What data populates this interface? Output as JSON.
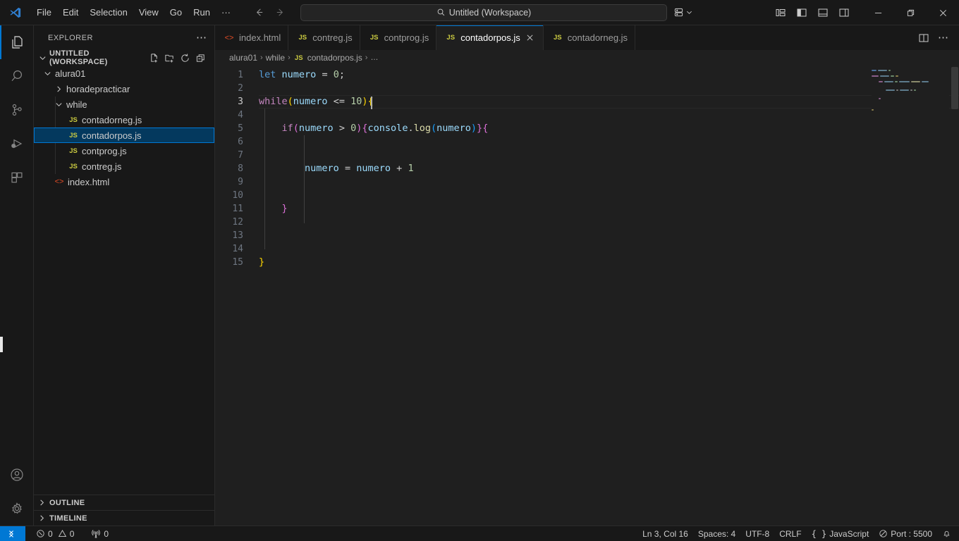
{
  "titlebar": {
    "logo_icon": "vscode-logo-icon",
    "menu": [
      {
        "label": "File",
        "name": "menu-file"
      },
      {
        "label": "Edit",
        "name": "menu-edit"
      },
      {
        "label": "Selection",
        "name": "menu-selection"
      },
      {
        "label": "View",
        "name": "menu-view"
      },
      {
        "label": "Go",
        "name": "menu-go"
      },
      {
        "label": "Run",
        "name": "menu-run"
      },
      {
        "label": "···",
        "name": "menu-more"
      }
    ],
    "back_icon": "arrow-left-icon",
    "forward_icon": "arrow-right-icon",
    "quick_input": {
      "icon": "search-icon",
      "value": "Untitled (Workspace)"
    },
    "remote_icon": "remote-explorer-icon",
    "remote_chevron": "chevron-down-icon",
    "layout_buttons": [
      {
        "name": "customize-layout-button",
        "icon": "customize-layout-icon"
      },
      {
        "name": "toggle-primary-sidebar-button",
        "icon": "panel-left-icon"
      },
      {
        "name": "toggle-panel-button",
        "icon": "panel-bottom-icon"
      },
      {
        "name": "toggle-secondary-sidebar-button",
        "icon": "panel-right-icon"
      }
    ],
    "window_controls": [
      {
        "name": "minimize-button",
        "icon": "minimize-icon",
        "glyph": "─"
      },
      {
        "name": "maximize-button",
        "icon": "restore-icon",
        "glyph": "❐"
      },
      {
        "name": "close-button",
        "icon": "close-icon",
        "glyph": "✕"
      }
    ]
  },
  "activitybar": {
    "top_items": [
      {
        "name": "activity-explorer",
        "icon": "files-icon",
        "active": true
      },
      {
        "name": "activity-search",
        "icon": "search-icon",
        "active": false
      },
      {
        "name": "activity-source-control",
        "icon": "source-control-icon",
        "active": false
      },
      {
        "name": "activity-run-debug",
        "icon": "run-and-debug-icon",
        "active": false
      },
      {
        "name": "activity-extensions",
        "icon": "extensions-icon",
        "active": false
      }
    ],
    "bottom_items": [
      {
        "name": "activity-accounts",
        "icon": "account-icon"
      },
      {
        "name": "activity-settings",
        "icon": "gear-icon"
      }
    ]
  },
  "sidebar": {
    "title": "EXPLORER",
    "more_actions_icon": "ellipsis-icon",
    "workspace": {
      "name": "UNTITLED (WORKSPACE)",
      "chevron": "chevron-down-icon",
      "actions": [
        {
          "name": "new-file-button",
          "icon": "new-file-icon"
        },
        {
          "name": "new-folder-button",
          "icon": "new-folder-icon"
        },
        {
          "name": "refresh-explorer-button",
          "icon": "refresh-icon"
        },
        {
          "name": "collapse-all-button",
          "icon": "collapse-all-icon"
        }
      ]
    },
    "tree": [
      {
        "label": "alura01",
        "type": "folder",
        "expanded": true,
        "depth": 0,
        "icon": "chevron-down-icon",
        "selected": false
      },
      {
        "label": "horadepracticar",
        "type": "folder",
        "expanded": false,
        "depth": 1,
        "icon": "chevron-right-icon",
        "selected": false
      },
      {
        "label": "while",
        "type": "folder",
        "expanded": true,
        "depth": 1,
        "icon": "chevron-down-icon",
        "selected": false
      },
      {
        "label": "contadorneg.js",
        "type": "js",
        "depth": 2,
        "icon": "js-file-icon",
        "selected": false
      },
      {
        "label": "contadorpos.js",
        "type": "js",
        "depth": 2,
        "icon": "js-file-icon",
        "selected": true
      },
      {
        "label": "contprog.js",
        "type": "js",
        "depth": 2,
        "icon": "js-file-icon",
        "selected": false
      },
      {
        "label": "contreg.js",
        "type": "js",
        "depth": 2,
        "icon": "js-file-icon",
        "selected": false
      },
      {
        "label": "index.html",
        "type": "html",
        "depth": 1,
        "icon": "html-file-icon",
        "selected": false
      }
    ],
    "panels": [
      {
        "label": "OUTLINE",
        "name": "outline-section",
        "chevron": "chevron-right-icon"
      },
      {
        "label": "TIMELINE",
        "name": "timeline-section",
        "chevron": "chevron-right-icon"
      }
    ]
  },
  "editor": {
    "tabs": [
      {
        "label": "index.html",
        "type": "html",
        "active": false,
        "name": "tab-index-html"
      },
      {
        "label": "contreg.js",
        "type": "js",
        "active": false,
        "name": "tab-contreg-js"
      },
      {
        "label": "contprog.js",
        "type": "js",
        "active": false,
        "name": "tab-contprog-js"
      },
      {
        "label": "contadorpos.js",
        "type": "js",
        "active": true,
        "name": "tab-contadorpos-js",
        "close_icon": "close-icon"
      },
      {
        "label": "contadorneg.js",
        "type": "js",
        "active": false,
        "name": "tab-contadorneg-js"
      }
    ],
    "tab_actions": [
      {
        "name": "split-editor-button",
        "icon": "split-editor-icon"
      },
      {
        "name": "editor-more-actions-button",
        "icon": "ellipsis-icon"
      }
    ],
    "breadcrumb": [
      {
        "label": "alura01",
        "icon": ""
      },
      {
        "label": "while",
        "icon": ""
      },
      {
        "label": "contadorpos.js",
        "icon": "js-file-icon"
      },
      {
        "label": "…",
        "icon": ""
      }
    ],
    "line_numbers": [
      "1",
      "2",
      "3",
      "4",
      "5",
      "6",
      "7",
      "8",
      "9",
      "10",
      "11",
      "12",
      "13",
      "14",
      "15"
    ],
    "current_line": 3,
    "code_lines": [
      {
        "n": 1,
        "text": "let numero = 0;"
      },
      {
        "n": 2,
        "text": ""
      },
      {
        "n": 3,
        "text": "while(numero <= 10){"
      },
      {
        "n": 4,
        "text": ""
      },
      {
        "n": 5,
        "text": "    if(numero > 0){console.log(numero)}{"
      },
      {
        "n": 6,
        "text": ""
      },
      {
        "n": 7,
        "text": ""
      },
      {
        "n": 8,
        "text": "        numero = numero + 1"
      },
      {
        "n": 9,
        "text": ""
      },
      {
        "n": 10,
        "text": ""
      },
      {
        "n": 11,
        "text": "    }"
      },
      {
        "n": 12,
        "text": ""
      },
      {
        "n": 13,
        "text": ""
      },
      {
        "n": 14,
        "text": ""
      },
      {
        "n": 15,
        "text": "}"
      }
    ]
  },
  "statusbar": {
    "remote_label": "",
    "remote_icon": "remote-indicator-icon",
    "left_items": [
      {
        "name": "problems-errors",
        "icon": "error-icon",
        "label": "0"
      },
      {
        "name": "problems-warnings",
        "icon": "warning-icon",
        "label": "0"
      },
      {
        "name": "ports-forwarded",
        "icon": "ports-icon",
        "label": "0"
      }
    ],
    "right_items": [
      {
        "name": "editor-selection-status",
        "label": "Ln 3, Col 16"
      },
      {
        "name": "editor-indentation",
        "label": "Spaces: 4"
      },
      {
        "name": "editor-encoding",
        "label": "UTF-8"
      },
      {
        "name": "editor-eol",
        "label": "CRLF"
      },
      {
        "name": "editor-language",
        "label": "JavaScript",
        "icon": "braces-icon"
      },
      {
        "name": "live-server-port",
        "label": "Port : 5500",
        "icon": "circle-slash-icon"
      },
      {
        "name": "notifications-bell",
        "label": "",
        "icon": "bell-icon"
      }
    ]
  },
  "colors": {
    "accent": "#0078d4",
    "selection": "#04395e",
    "editor_bg": "#1f1f1f",
    "chrome_bg": "#181818",
    "js_yellow": "#cbcb41",
    "html_orange": "#e44d26"
  }
}
